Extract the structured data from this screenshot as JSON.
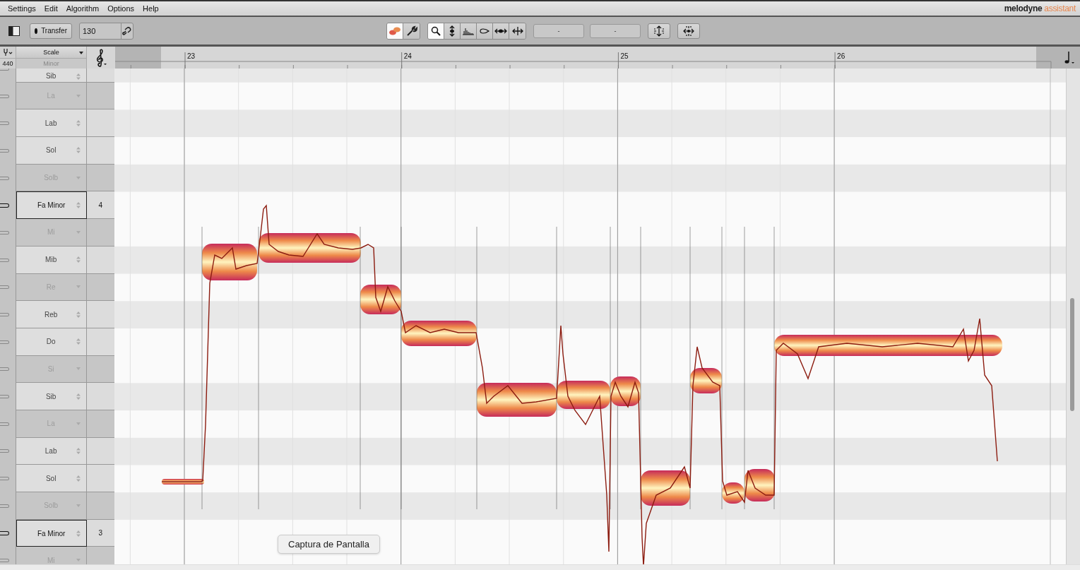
{
  "menu": [
    "Settings",
    "Edit",
    "Algorithm",
    "Options",
    "Help"
  ],
  "logo": {
    "brand": "melodyne",
    "edition": "assistant"
  },
  "toolbar": {
    "transfer": "Transfer",
    "tempo": "130",
    "modes": [
      {
        "kind": "blobs",
        "selected": true
      },
      {
        "kind": "macros",
        "selected": false
      }
    ],
    "tools": [
      {
        "kind": "zoom",
        "selected": true
      },
      {
        "kind": "pitch",
        "selected": false
      },
      {
        "kind": "amplitude",
        "selected": false
      },
      {
        "kind": "blob",
        "selected": false
      },
      {
        "kind": "time",
        "selected": false
      },
      {
        "kind": "separation",
        "selected": false
      }
    ],
    "fields": [
      "-",
      "-"
    ],
    "actions": [
      {
        "kind": "pitch_quantize"
      },
      {
        "kind": "time_quantize"
      }
    ]
  },
  "pitch_ruler": {
    "scale_menu": "Scale",
    "reference": "440",
    "mode": "Minor",
    "rows": [
      {
        "name": "Sib",
        "kind": "scale",
        "black_key": true
      },
      {
        "name": "La",
        "kind": "off",
        "black_key": false
      },
      {
        "name": "Lab",
        "kind": "scale",
        "black_key": true
      },
      {
        "name": "Sol",
        "kind": "scale",
        "black_key": false
      },
      {
        "name": "Solb",
        "kind": "off",
        "black_key": true
      },
      {
        "name": "Fa Minor",
        "kind": "root",
        "octave": "4",
        "black_key": false
      },
      {
        "name": "Mi",
        "kind": "off",
        "black_key": false
      },
      {
        "name": "Mib",
        "kind": "scale",
        "black_key": true
      },
      {
        "name": "Re",
        "kind": "off",
        "black_key": false
      },
      {
        "name": "Reb",
        "kind": "scale",
        "black_key": true
      },
      {
        "name": "Do",
        "kind": "scale",
        "black_key": false
      },
      {
        "name": "Si",
        "kind": "off",
        "black_key": false
      },
      {
        "name": "Sib",
        "kind": "scale",
        "black_key": true
      },
      {
        "name": "La",
        "kind": "off",
        "black_key": false
      },
      {
        "name": "Lab",
        "kind": "scale",
        "black_key": true
      },
      {
        "name": "Sol",
        "kind": "scale",
        "black_key": false
      },
      {
        "name": "Solb",
        "kind": "off",
        "black_key": true
      },
      {
        "name": "Fa Minor",
        "kind": "root",
        "octave": "3",
        "black_key": false
      },
      {
        "name": "Mi",
        "kind": "off",
        "black_key": false
      }
    ]
  },
  "timeline": {
    "bars": [
      "23",
      "24",
      "25",
      "26"
    ]
  },
  "tooltip": "Captura de Pantalla"
}
